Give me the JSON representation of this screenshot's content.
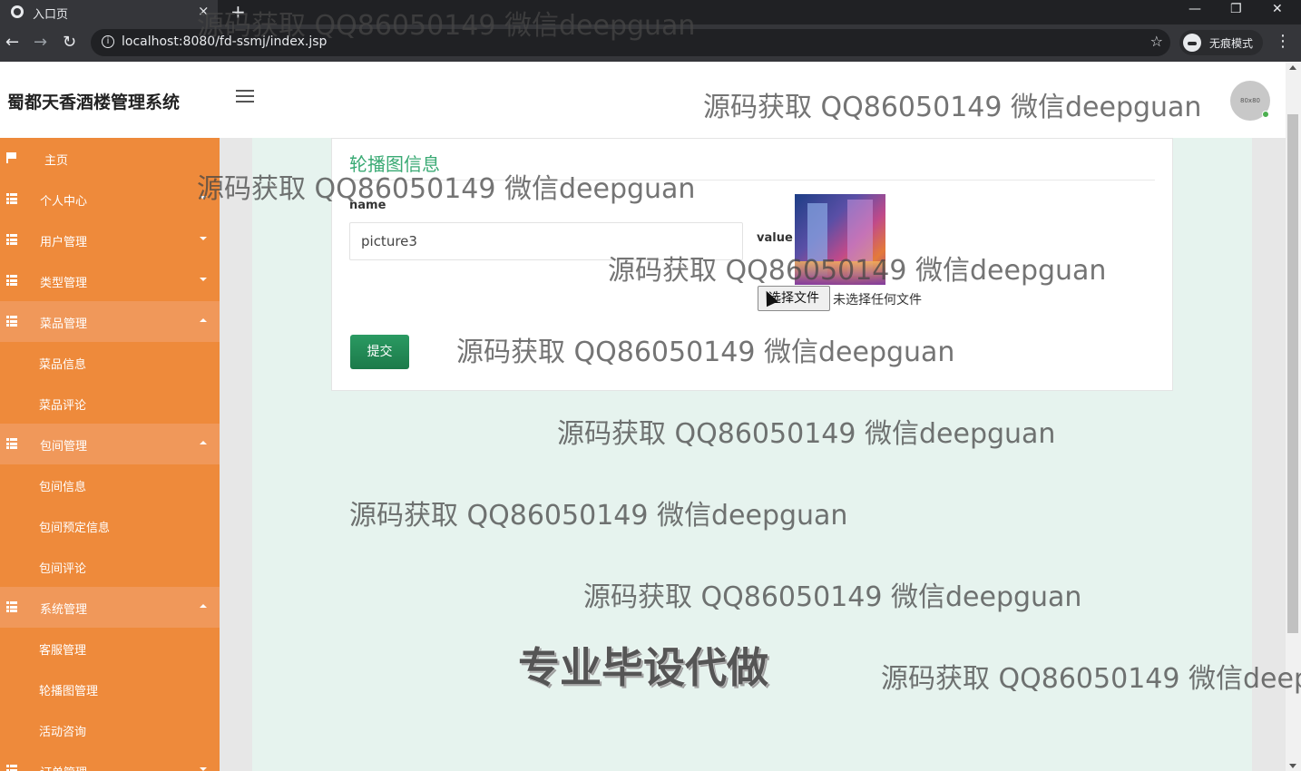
{
  "browser": {
    "tab_title": "入口页",
    "tab_close": "×",
    "new_tab": "+",
    "url": "localhost:8080/fd-ssmj/index.jsp",
    "incognito_label": "无痕模式",
    "minimize": "—",
    "restore": "❐",
    "close": "✕"
  },
  "header": {
    "brand": "蜀都天香酒楼管理系统",
    "avatar_text": "80x80"
  },
  "sidebar": {
    "items": [
      {
        "label": "主页",
        "icon": "flag-icon"
      },
      {
        "label": "个人中心",
        "icon": "grid-icon",
        "caret": "down"
      },
      {
        "label": "用户管理",
        "icon": "grid-icon",
        "caret": "down"
      },
      {
        "label": "类型管理",
        "icon": "grid-icon",
        "caret": "down"
      },
      {
        "label": "菜品管理",
        "icon": "grid-icon",
        "caret": "up",
        "children": [
          "菜品信息",
          "菜品评论"
        ]
      },
      {
        "label": "包间管理",
        "icon": "grid-icon",
        "caret": "up",
        "children": [
          "包间信息",
          "包间预定信息",
          "包间评论"
        ]
      },
      {
        "label": "系统管理",
        "icon": "grid-icon",
        "caret": "up",
        "children": [
          "客服管理",
          "轮播图管理",
          "活动咨询"
        ]
      },
      {
        "label": "订单管理",
        "icon": "grid-icon",
        "caret": "down"
      }
    ]
  },
  "form": {
    "title": "轮播图信息",
    "name_label": "name",
    "name_value": "picture3",
    "value_label": "value",
    "file_button": "选择文件",
    "file_status": "未选择任何文件",
    "submit_label": "提交"
  },
  "watermarks": {
    "text": "源码获取 QQ86050149 微信deepguan",
    "text_cut": "源码获取 QQ86050149 微信deep",
    "big": "专业毕设代做"
  },
  "colors": {
    "sidebar": "#ee8a3b",
    "accent_green": "#3aaa74",
    "content_bg": "#e6f3ee"
  }
}
